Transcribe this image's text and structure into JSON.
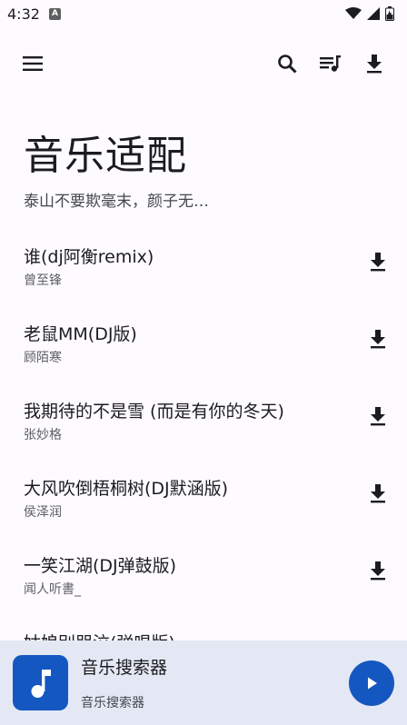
{
  "status_bar": {
    "time": "4:32",
    "app_icon_label": "A"
  },
  "top_bar": {
    "menu_icon": "menu-icon",
    "search_icon": "search-icon",
    "queue_icon": "queue-music-icon",
    "download_icon": "download-icon"
  },
  "header": {
    "title": "音乐适配",
    "subtitle": "泰山不要欺毫末，颜子无…"
  },
  "songs": [
    {
      "title": "谁(dj阿衡remix)",
      "artist": "曾至锋"
    },
    {
      "title": "老鼠MM(DJ版)",
      "artist": "顾陌寒"
    },
    {
      "title": "我期待的不是雪 (而是有你的冬天)",
      "artist": "张妙格"
    },
    {
      "title": "大风吹倒梧桐树(DJ默涵版)",
      "artist": "侯泽润"
    },
    {
      "title": "一笑江湖(DJ弹鼓版)",
      "artist": "闻人听書_"
    },
    {
      "title": "姑娘别哭泣(弹唱版)",
      "artist": ""
    }
  ],
  "player": {
    "title": "音乐搜索器",
    "subtitle": "音乐搜索器",
    "accent_color": "#1557c0"
  }
}
